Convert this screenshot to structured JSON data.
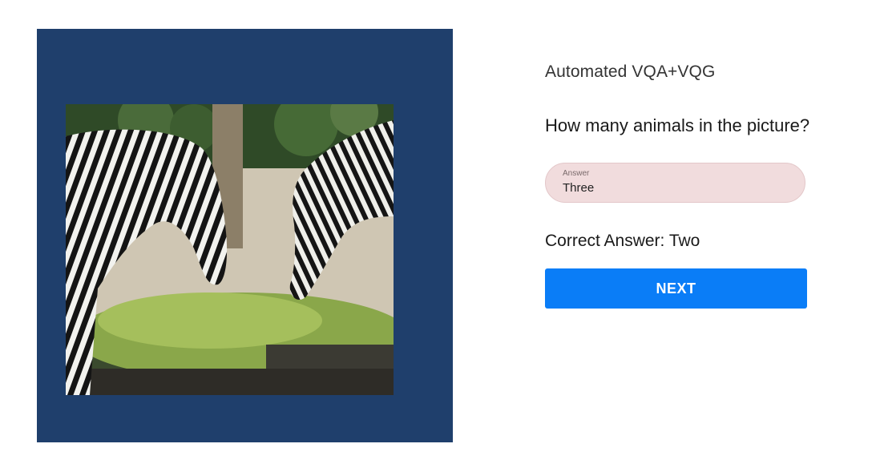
{
  "app_title": "Automated VQA+VQG",
  "question": "How many animals in the picture?",
  "answer_field": {
    "label": "Answer",
    "value": "Three"
  },
  "correct_answer_text": "Correct Answer: Two",
  "next_button_label": "NEXT",
  "colors": {
    "image_panel_bg": "#1f3f6c",
    "answer_field_bg": "#f1dcdd",
    "button_bg": "#0a7df7"
  }
}
